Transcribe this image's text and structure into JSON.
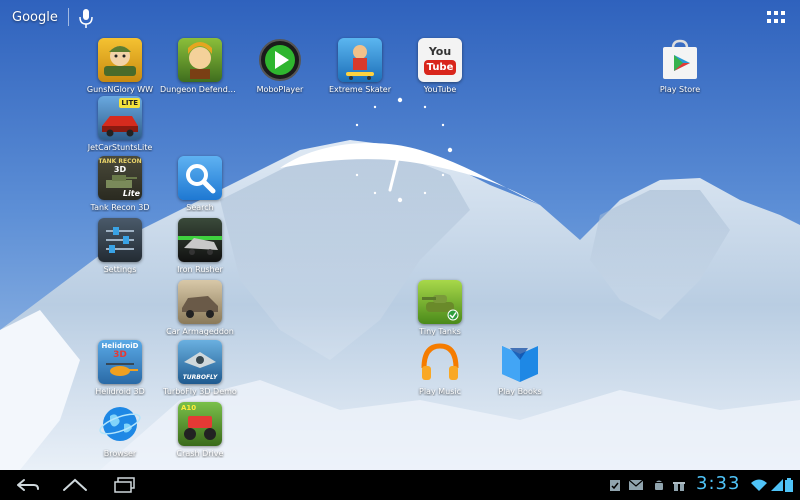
{
  "search": {
    "label": "Google"
  },
  "apps": [
    {
      "id": "gunsnglory",
      "label": "GunsNGlory WW"
    },
    {
      "id": "dungeon",
      "label": "Dungeon Defenders"
    },
    {
      "id": "moboplayer",
      "label": "MoboPlayer"
    },
    {
      "id": "extremeskater",
      "label": "Extreme Skater"
    },
    {
      "id": "youtube",
      "label": "YouTube"
    },
    {
      "id": "playstore",
      "label": "Play Store"
    },
    {
      "id": "jetcar",
      "label": "JetCarStuntsLite"
    },
    {
      "id": "tankrecon",
      "label": "Tank Recon 3D"
    },
    {
      "id": "search",
      "label": "Search"
    },
    {
      "id": "settings",
      "label": "Settings"
    },
    {
      "id": "ironrusher",
      "label": "Iron Rusher"
    },
    {
      "id": "cararmageddon",
      "label": "Car Armageddon"
    },
    {
      "id": "tinytanks",
      "label": "Tiny Tanks"
    },
    {
      "id": "helidroid",
      "label": "Helidroid 3D"
    },
    {
      "id": "turbofly",
      "label": "TurboFly 3D Demo"
    },
    {
      "id": "playmusic",
      "label": "Play Music"
    },
    {
      "id": "playbooks",
      "label": "Play Books"
    },
    {
      "id": "browser",
      "label": "Browser"
    },
    {
      "id": "crashdrive",
      "label": "Crash Drive"
    }
  ],
  "icon_text": {
    "youtube_you": "You",
    "youtube_tube": "Tube",
    "jetcar_badge": "LITE",
    "tankrecon_top": "TANK RECON",
    "tankrecon_3d": "3D",
    "tankrecon_lite": "Lite",
    "helidroid_title": "HelidroiD",
    "helidroid_3d": "3D",
    "turbofly_text": "TURBOFLY",
    "crashdrive_badge": "A10"
  },
  "status": {
    "time": "3:33"
  },
  "colors": {
    "accent": "#4fc3f7",
    "navbar": "#000000",
    "sky_top": "#3b6fc4",
    "sky_bottom": "#9cc3ea"
  }
}
